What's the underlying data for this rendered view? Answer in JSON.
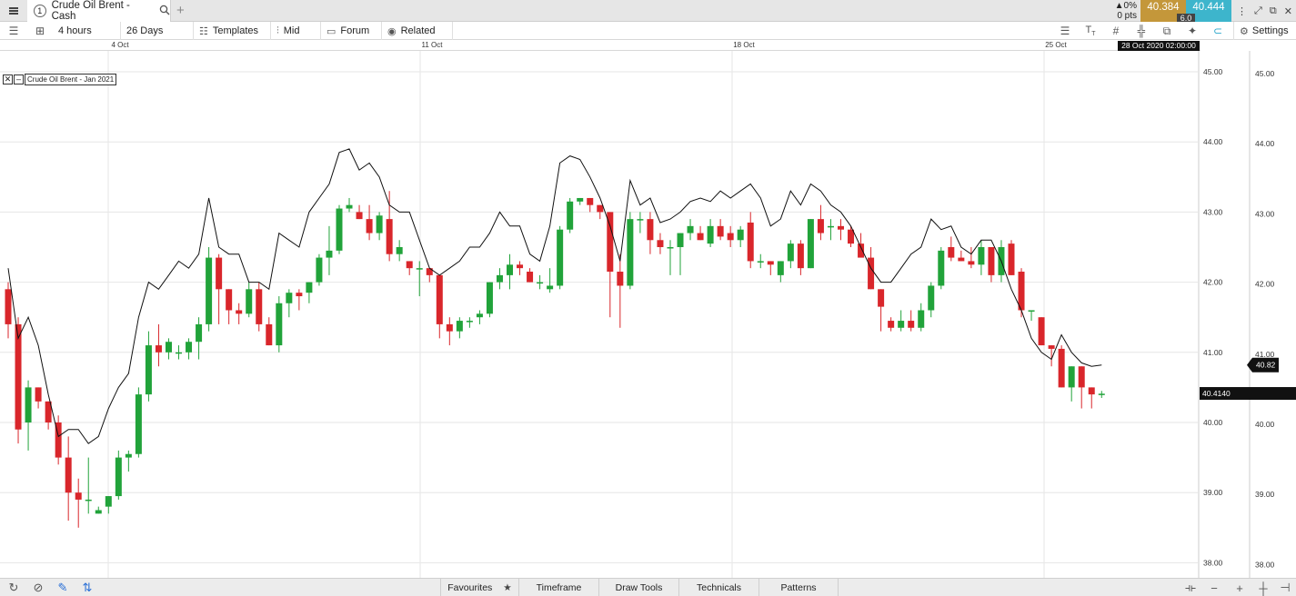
{
  "tabbar": {
    "tab_number": "1",
    "tab_title": "Crude Oil Brent - Cash",
    "new_tab": "+",
    "change_pct": "▲0%",
    "change_pts": "0 pts",
    "bid": "40.384",
    "ask": "40.444",
    "spread": "6.0"
  },
  "toolbar": {
    "interval": "4 hours",
    "period": "26 Days",
    "templates": "Templates",
    "price_type": "Mid",
    "forum": "Forum",
    "related": "Related",
    "settings": "Settings"
  },
  "chart_header": {
    "cursor_date": "28 Oct 2020 02:00:00",
    "instrument_label": "Crude Oil Brent - Jan 2021"
  },
  "bottombar": {
    "tabs": [
      "Favourites",
      "Timeframe",
      "Draw Tools",
      "Technicals",
      "Patterns"
    ],
    "zoom_minus": "−",
    "zoom_plus": "+"
  },
  "colors": {
    "up": "#21a33a",
    "down": "#d9262b",
    "line": "#111111"
  },
  "chart_data": {
    "type": "candlestick",
    "x_labels": [
      "4 Oct",
      "11 Oct",
      "18 Oct",
      "25 Oct"
    ],
    "ylim": [
      37.75,
      45.25
    ],
    "y_ticks": [
      "45.00",
      "44.00",
      "43.00",
      "42.00",
      "41.00",
      "40.00",
      "39.00",
      "38.00"
    ],
    "current_price": "40.82",
    "crosshair_price": "40.4140",
    "candles": [
      [
        41.9,
        42.0,
        41.2,
        41.4
      ],
      [
        41.4,
        41.5,
        39.7,
        39.9
      ],
      [
        40.0,
        40.6,
        39.6,
        40.5
      ],
      [
        40.5,
        40.5,
        40.2,
        40.3
      ],
      [
        40.3,
        40.3,
        39.9,
        40.0
      ],
      [
        40.0,
        40.1,
        39.4,
        39.5
      ],
      [
        39.5,
        39.8,
        38.6,
        39.0
      ],
      [
        39.0,
        39.2,
        38.5,
        38.9
      ],
      [
        38.9,
        39.5,
        38.7,
        38.9
      ],
      [
        38.7,
        38.8,
        38.7,
        38.75
      ],
      [
        38.8,
        38.95,
        38.7,
        38.95
      ],
      [
        38.95,
        39.6,
        38.9,
        39.5
      ],
      [
        39.5,
        39.6,
        39.3,
        39.55
      ],
      [
        39.55,
        40.5,
        39.5,
        40.4
      ],
      [
        40.4,
        41.3,
        40.3,
        41.1
      ],
      [
        41.1,
        41.4,
        40.8,
        41.0
      ],
      [
        41.0,
        41.2,
        40.9,
        41.15
      ],
      [
        41.0,
        41.1,
        40.9,
        41.0
      ],
      [
        41.0,
        41.2,
        40.9,
        41.15
      ],
      [
        41.15,
        41.5,
        40.9,
        41.4
      ],
      [
        41.4,
        42.5,
        41.3,
        42.35
      ],
      [
        42.35,
        42.4,
        41.4,
        41.9
      ],
      [
        41.9,
        41.9,
        41.4,
        41.6
      ],
      [
        41.6,
        41.7,
        41.4,
        41.55
      ],
      [
        41.55,
        42.0,
        41.5,
        41.9
      ],
      [
        41.9,
        42.0,
        41.3,
        41.4
      ],
      [
        41.4,
        41.5,
        41.1,
        41.1
      ],
      [
        41.1,
        41.8,
        41.0,
        41.7
      ],
      [
        41.7,
        41.9,
        41.5,
        41.85
      ],
      [
        41.85,
        41.9,
        41.6,
        41.8
      ],
      [
        41.85,
        42.0,
        41.7,
        42.0
      ],
      [
        42.0,
        42.4,
        41.95,
        42.35
      ],
      [
        42.35,
        42.8,
        42.1,
        42.45
      ],
      [
        42.45,
        43.1,
        42.4,
        43.05
      ],
      [
        43.05,
        43.2,
        43.0,
        43.1
      ],
      [
        43.0,
        43.1,
        42.9,
        42.9
      ],
      [
        42.9,
        43.1,
        42.6,
        42.7
      ],
      [
        42.7,
        43.0,
        42.6,
        42.95
      ],
      [
        42.9,
        43.3,
        42.3,
        42.4
      ],
      [
        42.4,
        42.6,
        42.3,
        42.5
      ],
      [
        42.3,
        42.3,
        42.1,
        42.2
      ],
      [
        42.2,
        42.3,
        41.8,
        42.2
      ],
      [
        42.2,
        42.2,
        42.0,
        42.1
      ],
      [
        42.1,
        42.1,
        41.2,
        41.4
      ],
      [
        41.4,
        41.5,
        41.1,
        41.3
      ],
      [
        41.3,
        41.5,
        41.2,
        41.45
      ],
      [
        41.45,
        41.5,
        41.35,
        41.45
      ],
      [
        41.5,
        41.6,
        41.4,
        41.55
      ],
      [
        41.55,
        42.0,
        41.5,
        42.0
      ],
      [
        42.0,
        42.2,
        41.9,
        42.1
      ],
      [
        42.1,
        42.4,
        41.9,
        42.25
      ],
      [
        42.25,
        42.3,
        42.1,
        42.2
      ],
      [
        42.15,
        42.2,
        42.0,
        42.0
      ],
      [
        42.0,
        42.1,
        41.9,
        42.0
      ],
      [
        41.9,
        42.2,
        41.85,
        41.95
      ],
      [
        41.95,
        42.8,
        41.9,
        42.75
      ],
      [
        42.75,
        43.2,
        42.7,
        43.15
      ],
      [
        43.15,
        43.2,
        43.1,
        43.2
      ],
      [
        43.2,
        43.2,
        43.0,
        43.1
      ],
      [
        43.1,
        43.1,
        42.9,
        43.0
      ],
      [
        43.0,
        43.0,
        41.5,
        42.15
      ],
      [
        42.15,
        42.4,
        41.35,
        41.95
      ],
      [
        41.95,
        43.0,
        41.9,
        42.9
      ],
      [
        42.9,
        43.0,
        42.7,
        42.9
      ],
      [
        42.9,
        43.0,
        42.4,
        42.6
      ],
      [
        42.6,
        42.7,
        42.4,
        42.5
      ],
      [
        42.5,
        42.6,
        42.1,
        42.5
      ],
      [
        42.5,
        42.7,
        42.1,
        42.7
      ],
      [
        42.7,
        42.9,
        42.6,
        42.8
      ],
      [
        42.7,
        42.8,
        42.6,
        42.6
      ],
      [
        42.55,
        42.9,
        42.5,
        42.8
      ],
      [
        42.8,
        42.9,
        42.6,
        42.65
      ],
      [
        42.7,
        42.8,
        42.5,
        42.6
      ],
      [
        42.6,
        42.8,
        42.5,
        42.75
      ],
      [
        42.85,
        43.0,
        42.2,
        42.3
      ],
      [
        42.3,
        42.4,
        42.2,
        42.3
      ],
      [
        42.3,
        42.3,
        42.1,
        42.25
      ],
      [
        42.1,
        42.3,
        42.0,
        42.3
      ],
      [
        42.3,
        42.6,
        42.2,
        42.55
      ],
      [
        42.55,
        42.6,
        42.1,
        42.2
      ],
      [
        42.2,
        42.9,
        42.2,
        42.9
      ],
      [
        42.9,
        43.1,
        42.6,
        42.7
      ],
      [
        42.8,
        42.9,
        42.6,
        42.8
      ],
      [
        42.8,
        42.9,
        42.6,
        42.75
      ],
      [
        42.75,
        42.8,
        42.5,
        42.55
      ],
      [
        42.55,
        42.7,
        42.4,
        42.35
      ],
      [
        42.35,
        42.5,
        41.9,
        41.9
      ],
      [
        41.9,
        41.9,
        41.3,
        41.65
      ],
      [
        41.45,
        41.5,
        41.3,
        41.35
      ],
      [
        41.35,
        41.6,
        41.3,
        41.45
      ],
      [
        41.45,
        41.6,
        41.3,
        41.35
      ],
      [
        41.35,
        41.7,
        41.3,
        41.6
      ],
      [
        41.6,
        42.0,
        41.5,
        41.95
      ],
      [
        41.95,
        42.5,
        41.9,
        42.45
      ],
      [
        42.5,
        42.65,
        42.3,
        42.35
      ],
      [
        42.35,
        42.45,
        42.3,
        42.3
      ],
      [
        42.3,
        42.5,
        42.2,
        42.25
      ],
      [
        42.25,
        42.6,
        42.1,
        42.5
      ],
      [
        42.5,
        42.5,
        42.0,
        42.1
      ],
      [
        42.1,
        42.6,
        42.0,
        42.5
      ],
      [
        42.55,
        42.6,
        42.1,
        42.1
      ],
      [
        42.15,
        42.2,
        41.5,
        41.6
      ],
      [
        41.6,
        41.6,
        41.45,
        41.6
      ],
      [
        41.5,
        41.5,
        41.1,
        41.1
      ],
      [
        41.1,
        41.1,
        40.8,
        41.05
      ],
      [
        41.05,
        41.1,
        40.5,
        40.5
      ],
      [
        40.5,
        40.8,
        40.3,
        40.8
      ],
      [
        40.8,
        40.8,
        40.2,
        40.5
      ],
      [
        40.5,
        40.5,
        40.2,
        40.4
      ],
      [
        40.4,
        40.45,
        40.35,
        40.41
      ]
    ],
    "line": [
      42.2,
      41.2,
      41.5,
      41.1,
      40.4,
      39.8,
      39.9,
      39.9,
      39.7,
      39.8,
      40.2,
      40.5,
      40.7,
      41.5,
      42.0,
      41.9,
      42.1,
      42.3,
      42.2,
      42.4,
      43.2,
      42.5,
      42.4,
      42.4,
      42.0,
      42.0,
      41.9,
      42.7,
      42.6,
      42.5,
      43.0,
      43.2,
      43.4,
      43.85,
      43.9,
      43.6,
      43.7,
      43.5,
      43.1,
      43.0,
      43.0,
      42.6,
      42.2,
      42.1,
      42.2,
      42.3,
      42.5,
      42.5,
      42.7,
      43.0,
      42.8,
      42.8,
      42.4,
      42.3,
      42.8,
      43.7,
      43.8,
      43.75,
      43.5,
      43.2,
      42.8,
      42.3,
      43.45,
      43.1,
      43.2,
      42.85,
      42.9,
      43.0,
      43.15,
      43.2,
      43.15,
      43.3,
      43.2,
      43.3,
      43.4,
      43.2,
      42.8,
      42.9,
      43.3,
      43.1,
      43.4,
      43.3,
      43.1,
      43.0,
      42.8,
      42.5,
      42.2,
      42.0,
      42.0,
      42.2,
      42.4,
      42.5,
      42.9,
      42.75,
      42.8,
      42.5,
      42.4,
      42.6,
      42.6,
      42.3,
      41.9,
      41.6,
      41.2,
      41.0,
      40.9,
      41.25,
      41.0,
      40.85,
      40.8,
      40.82
    ]
  }
}
